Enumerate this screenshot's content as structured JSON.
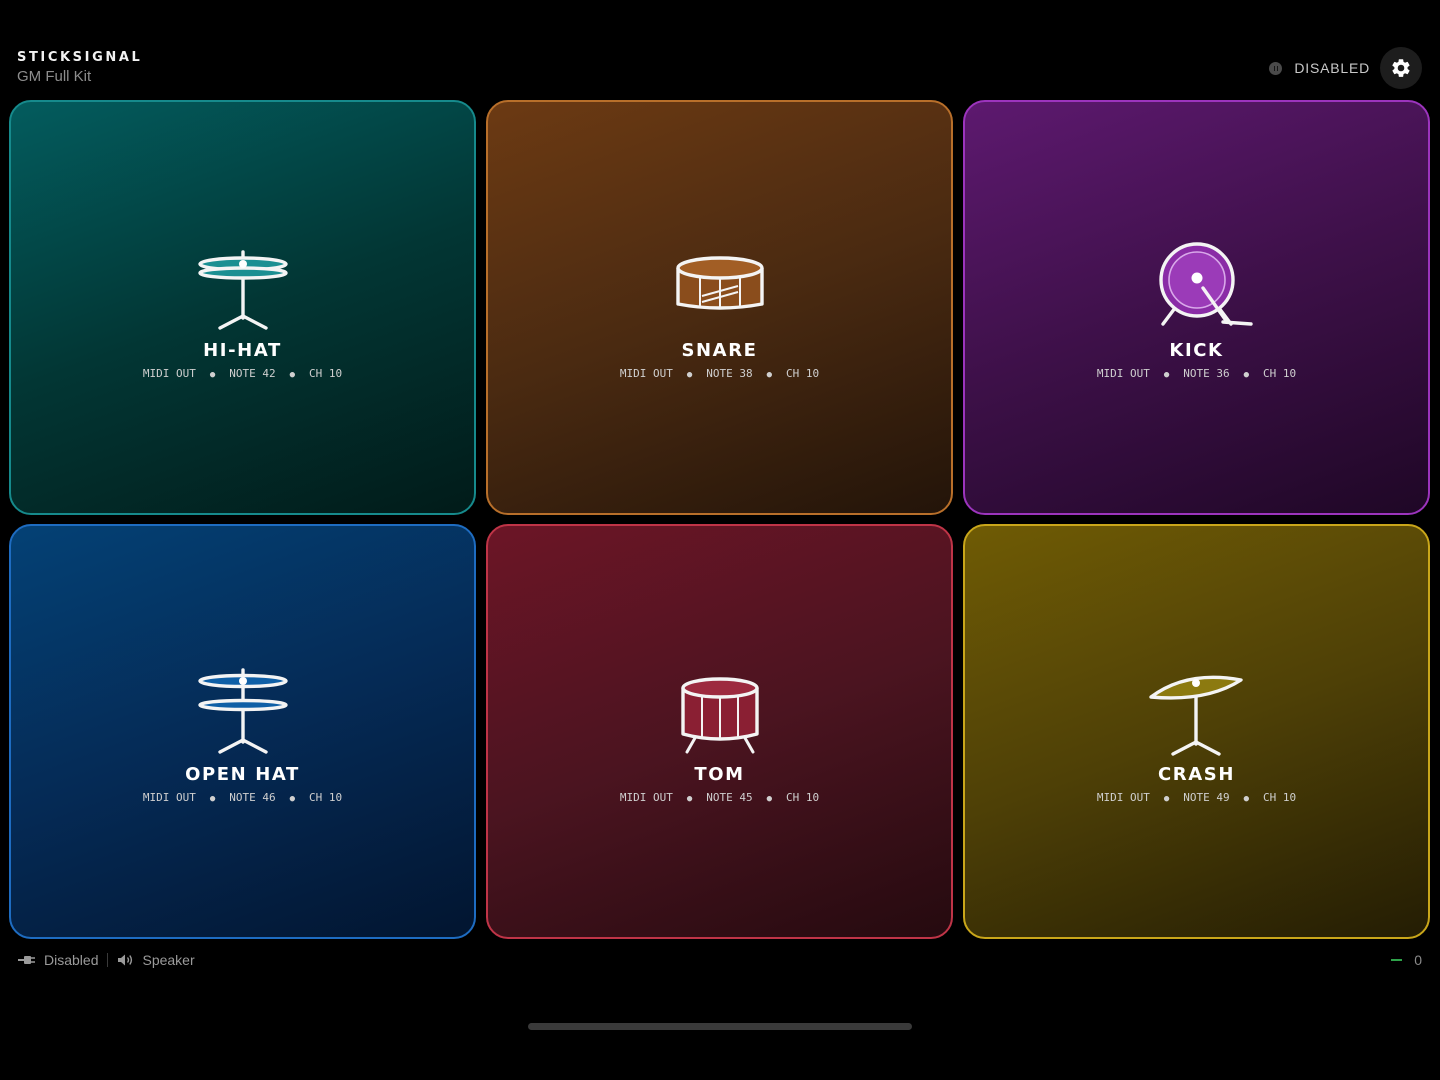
{
  "header": {
    "app_name": "STICKSIGNAL",
    "kit_name": "GM Full Kit",
    "status_label": "DISABLED",
    "settings_icon": "gear-icon"
  },
  "pads": [
    {
      "name": "HI-HAT",
      "output": "MIDI OUT",
      "note": "NOTE 42",
      "channel": "CH 10",
      "accent": "#168a8c",
      "icon": "hihat-icon"
    },
    {
      "name": "SNARE",
      "output": "MIDI OUT",
      "note": "NOTE 38",
      "channel": "CH 10",
      "accent": "#b86f2a",
      "icon": "snare-drum-icon"
    },
    {
      "name": "KICK",
      "output": "MIDI OUT",
      "note": "NOTE 36",
      "channel": "CH 10",
      "accent": "#9c34bd",
      "icon": "kick-drum-icon"
    },
    {
      "name": "OPEN HAT",
      "output": "MIDI OUT",
      "note": "NOTE 46",
      "channel": "CH 10",
      "accent": "#1e6cc1",
      "icon": "open-hihat-icon"
    },
    {
      "name": "TOM",
      "output": "MIDI OUT",
      "note": "NOTE 45",
      "channel": "CH 10",
      "accent": "#bf3447",
      "icon": "tom-drum-icon"
    },
    {
      "name": "CRASH",
      "output": "MIDI OUT",
      "note": "NOTE 49",
      "channel": "CH 10",
      "accent": "#c9a61a",
      "icon": "crash-cymbal-icon"
    }
  ],
  "footer": {
    "connection_label": "Disabled",
    "connection_icon": "plug-icon",
    "audio_label": "Speaker",
    "audio_icon": "speaker-icon",
    "level_icon": "level-indicator-icon",
    "counter": "0"
  }
}
